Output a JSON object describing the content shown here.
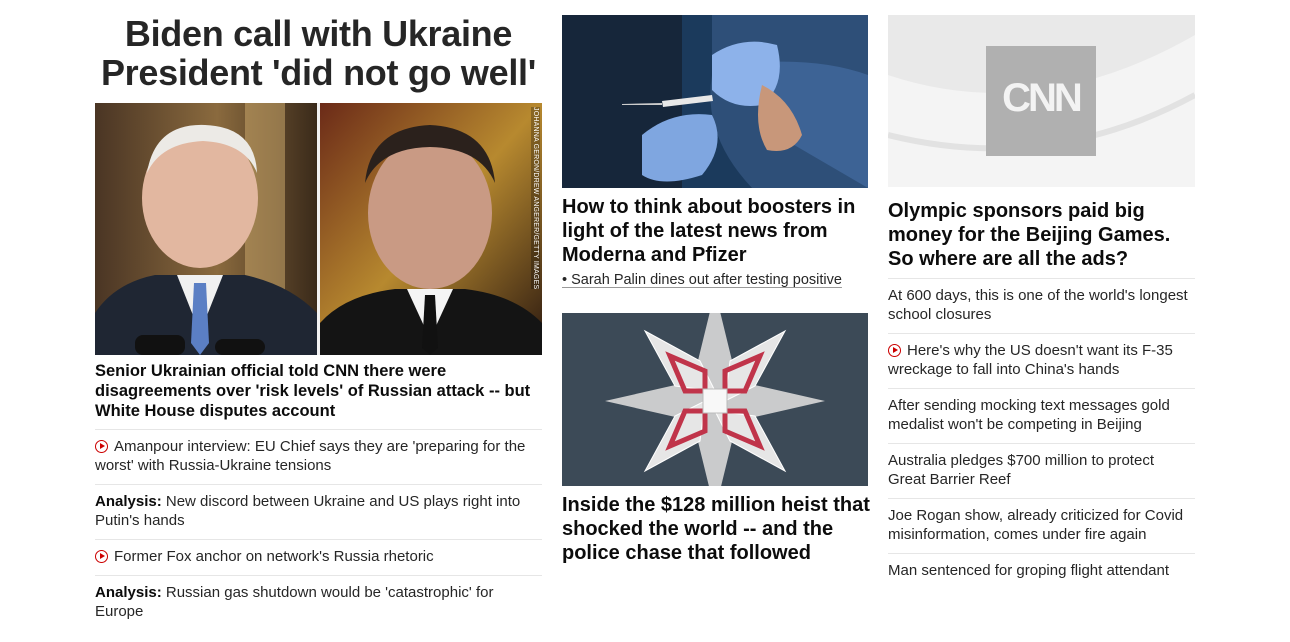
{
  "main_story": {
    "headline": "Biden call with Ukraine President 'did not go well'",
    "photo_credit": "JOHANNA GERON/DREW ANGERER/GETTY IMAGES",
    "lead": "Senior Ukrainian official told CNN there were disagreements over 'risk levels' of Russian attack -- but White House disputes account",
    "related": [
      {
        "prefix": "",
        "text": "Amanpour interview: EU Chief says they are 'preparing for the worst' with Russia-Ukraine tensions",
        "video": true
      },
      {
        "prefix": "Analysis:",
        "text": "New discord between Ukraine and US plays right into Putin's hands",
        "video": false
      },
      {
        "prefix": "",
        "text": "Former Fox anchor on network's Russia rhetoric",
        "video": true
      },
      {
        "prefix": "Analysis:",
        "text": "Russian gas shutdown would be 'catastrophic' for Europe",
        "video": false
      }
    ]
  },
  "column2": {
    "story1": {
      "headline": "How to think about boosters in light of the latest news from Moderna and Pfizer",
      "subline": "• Sarah Palin dines out after testing positive"
    },
    "story2": {
      "headline": "Inside the $128 million heist that shocked the world -- and the police chase that followed"
    }
  },
  "column3": {
    "logo_text": "CNN",
    "headline": "Olympic sponsors paid big money for the Beijing Games. So where are all the ads?",
    "items": [
      {
        "text": "At 600 days, this is one of the world's longest school closures",
        "video": false
      },
      {
        "text": "Here's why the US doesn't want its F-35 wreckage to fall into China's hands",
        "video": true
      },
      {
        "text": "After sending mocking text messages gold medalist won't be competing in Beijing",
        "video": false
      },
      {
        "text": "Australia pledges $700 million to protect Great Barrier Reef",
        "video": false
      },
      {
        "text": "Joe Rogan show, already criticized for Covid misinformation, comes under fire again",
        "video": false
      },
      {
        "text": "Man sentenced for groping flight attendant",
        "video": false
      }
    ]
  },
  "colors": {
    "accent_red": "#cc0000",
    "text": "#0c0c0c",
    "divider": "#e6e6e6"
  },
  "icons": {
    "video": "play-circle-icon",
    "logo": "cnn-logo"
  }
}
